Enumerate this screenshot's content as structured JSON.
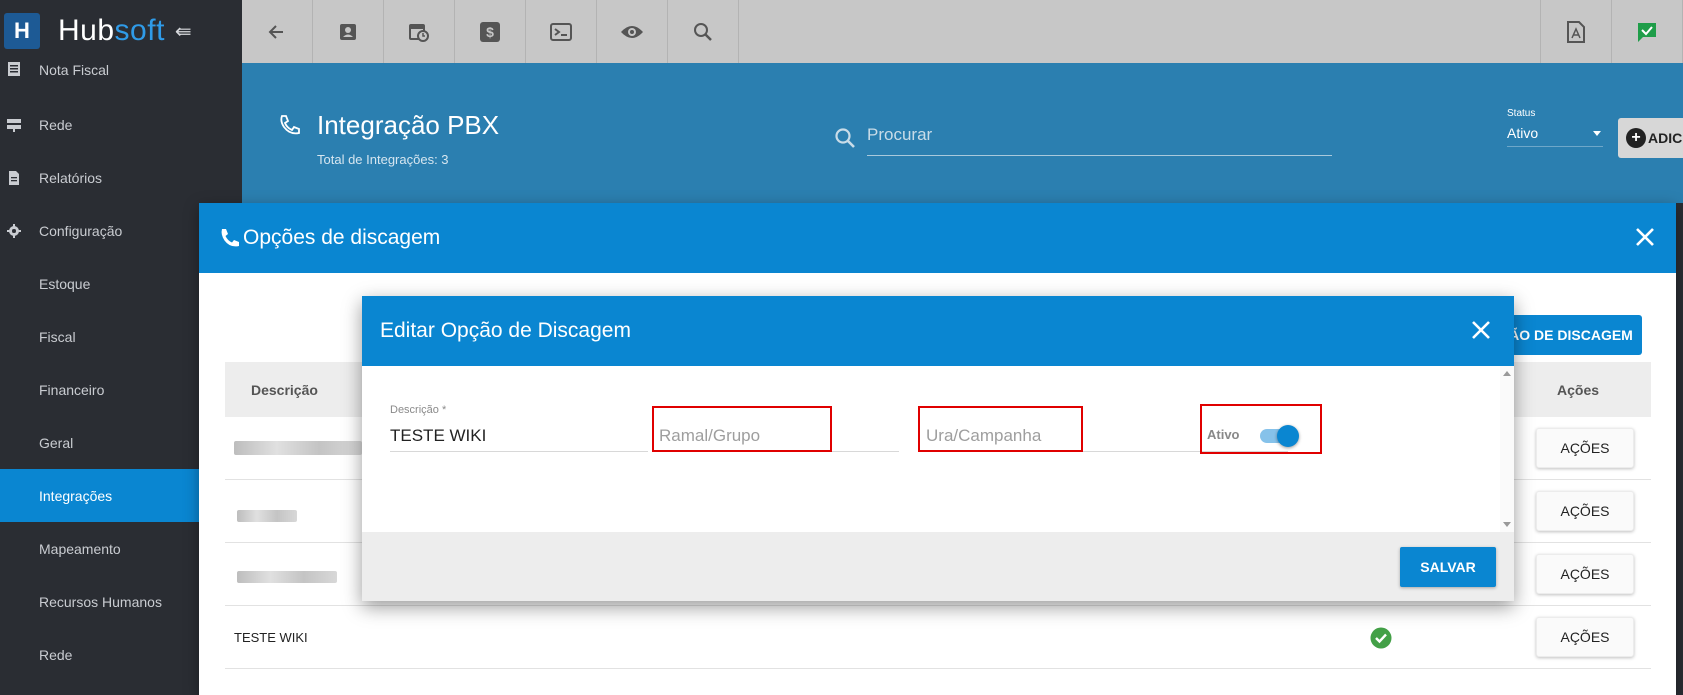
{
  "brand": {
    "name_part1": "Hub",
    "name_part2": "soft",
    "logo_letter": "H"
  },
  "sidebar": {
    "items": [
      {
        "label": "Nota Fiscal",
        "icon": "document-icon"
      },
      {
        "label": "Rede",
        "icon": "network-icon"
      },
      {
        "label": "Relatórios",
        "icon": "report-icon"
      },
      {
        "label": "Configuração",
        "icon": "gear-icon"
      },
      {
        "label": "Estoque"
      },
      {
        "label": "Fiscal"
      },
      {
        "label": "Financeiro"
      },
      {
        "label": "Geral"
      },
      {
        "label": "Integrações",
        "active": true
      },
      {
        "label": "Mapeamento"
      },
      {
        "label": "Recursos Humanos"
      },
      {
        "label": "Rede"
      }
    ]
  },
  "toolbar": {
    "buttons": [
      "back-arrow-icon",
      "contact-card-icon",
      "calendar-clock-icon",
      "dollar-icon",
      "terminal-icon",
      "eye-icon",
      "search-icon"
    ],
    "right_buttons": [
      "pdf-icon",
      "chat-check-icon"
    ]
  },
  "header": {
    "title": "Integração PBX",
    "subtitle": "Total de Integrações: 3",
    "search_placeholder": "Procurar",
    "status_label": "Status",
    "status_value": "Ativo",
    "add_label": "ADIC"
  },
  "modal1": {
    "title": "Opções de discagem",
    "add_button": "ÃO DE DISCAGEM",
    "columns": {
      "descricao": "Descrição",
      "acoes": "Ações"
    },
    "rows": [
      {
        "description": "",
        "blurred": true,
        "action": "AÇÕES"
      },
      {
        "description": "",
        "blurred": true,
        "action": "AÇÕES"
      },
      {
        "description": "",
        "blurred": true,
        "action": "AÇÕES"
      },
      {
        "description": "TESTE WIKI",
        "blurred": false,
        "active": true,
        "action": "AÇÕES"
      }
    ]
  },
  "modal2": {
    "title": "Editar Opção de Discagem",
    "descricao_label": "Descrição *",
    "descricao_value": "TESTE WIKI",
    "ramal_placeholder": "Ramal/Grupo",
    "ura_placeholder": "Ura/Campanha",
    "ativo_label": "Ativo",
    "ativo_on": true,
    "save_label": "SALVAR"
  },
  "colors": {
    "primary": "#0a86d1",
    "sidebar_bg": "#2a2d33",
    "header_bg": "#2b7fb0",
    "highlight_red": "#e00000",
    "success_green": "#43a047"
  }
}
